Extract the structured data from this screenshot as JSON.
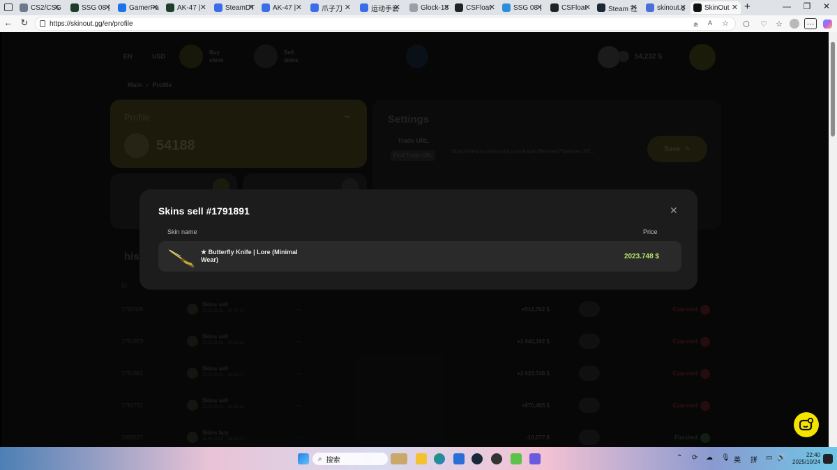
{
  "browser": {
    "tabs": [
      {
        "title": "CS2/CSG",
        "color": "#6b7b8c"
      },
      {
        "title": "SSG 08 |",
        "color": "#1f3d2a"
      },
      {
        "title": "GamerPa",
        "color": "#1a73e8"
      },
      {
        "title": "AK-47 |",
        "color": "#1f3d2a"
      },
      {
        "title": "SteamDT",
        "color": "#3a6ee8"
      },
      {
        "title": "AK-47 |",
        "color": "#3a6ee8"
      },
      {
        "title": "爪子刀",
        "color": "#3a6ee8"
      },
      {
        "title": "运动手套",
        "color": "#3a6ee8"
      },
      {
        "title": "Glock-18",
        "color": "#9aa0a6"
      },
      {
        "title": "CSFloat",
        "color": "#222222"
      },
      {
        "title": "SSG 08 |",
        "color": "#2a8fd8"
      },
      {
        "title": "CSFloat",
        "color": "#222222"
      },
      {
        "title": "Steam 社",
        "color": "#1b2838"
      },
      {
        "title": "skinout.g",
        "color": "#4a6fd8"
      },
      {
        "title": "SkinOut",
        "color": "#111111"
      }
    ],
    "url": "https://skinout.gg/en/profile"
  },
  "site": {
    "lang": "EN",
    "currency": "USD",
    "buy_label": "Buy skins",
    "sell_label": "Sell skins",
    "balance": "54,232 $",
    "breadcrumb_main": "Main",
    "breadcrumb_sep": "›",
    "breadcrumb_current": "Profile",
    "profile_title": "Profile",
    "profile_id": "54188",
    "settings_title": "Settings",
    "trade_url_label": "Trade URL",
    "find_trade_url": "Find Trade URL",
    "trade_url_value": "https://steamcommunity.com/tradeoffer/new/?partner=93...",
    "save_label": "Save",
    "history_title": "his",
    "id_col": "ID",
    "history_rows": [
      {
        "id": "1792049",
        "type": "Skins sell",
        "date": "23.10.2025 – 09:47:14",
        "dash": "–",
        "amount": "+512,762 $",
        "status": "Canceled"
      },
      {
        "id": "1791973",
        "type": "Skins sell",
        "date": "23.10.2025 – 09:53:32",
        "dash": "–",
        "amount": "+1 044,192 $",
        "status": "Canceled"
      },
      {
        "id": "1791891",
        "type": "Skins sell",
        "date": "23.10.2025 – 09:41:07",
        "dash": "–",
        "amount": "+2 023,748 $",
        "status": "Canceled"
      },
      {
        "id": "1791781",
        "type": "Skins sell",
        "date": "23.10.2025 – 09:38:52",
        "dash": "–",
        "amount": "+870,405 $",
        "status": "Canceled"
      },
      {
        "id": "1050537",
        "type": "Skins buy",
        "date": "11.09.2025 – 16:20:41",
        "dash": "–",
        "amount": "-10,577 $",
        "status": "Finished"
      }
    ]
  },
  "modal": {
    "title": "Skins sell #1791891",
    "col_name": "Skin name",
    "col_price": "Price",
    "item_name": "★ Butterfly Knife | Lore (Minimal Wear)",
    "item_price": "2023.748 $"
  },
  "taskbar": {
    "search_placeholder": "搜索",
    "ime1": "英",
    "ime2": "拼",
    "time": "22:40",
    "date": "2025/10/24"
  }
}
